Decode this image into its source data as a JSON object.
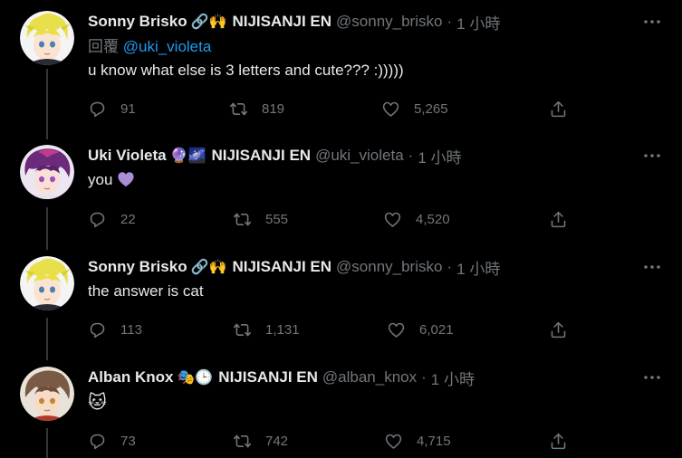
{
  "colors": {
    "background": "#000000",
    "text_primary": "#e7e9ea",
    "text_secondary": "#71767b",
    "link": "#1d9bf0",
    "thread_line": "#333639"
  },
  "tweets": [
    {
      "name": "Sonny Brisko",
      "emojis": "🔗🙌",
      "org": "NIJISANJI EN",
      "handle": "@sonny_brisko",
      "dot": "·",
      "time": "1 小時",
      "reply_label": "回覆",
      "reply_mention": "@uki_violeta",
      "text": "u know what else is 3 letters and cute??? :)))))",
      "avatar": "sonny-avatar",
      "replies": "91",
      "retweets": "819",
      "likes": "5,265"
    },
    {
      "name": "Uki Violeta",
      "emojis": "🔮🌌",
      "org": "NIJISANJI EN",
      "handle": "@uki_violeta",
      "dot": "·",
      "time": "1 小時",
      "text": "you",
      "text_icon": "purple-heart-icon",
      "avatar": "uki-avatar",
      "replies": "22",
      "retweets": "555",
      "likes": "4,520"
    },
    {
      "name": "Sonny Brisko",
      "emojis": "🔗🙌",
      "org": "NIJISANJI EN",
      "handle": "@sonny_brisko",
      "dot": "·",
      "time": "1 小時",
      "text": "the answer is cat",
      "avatar": "sonny-avatar",
      "replies": "113",
      "retweets": "1,131",
      "likes": "6,021"
    },
    {
      "name": "Alban Knox",
      "emojis": "🎭🕒",
      "org": "NIJISANJI EN",
      "handle": "@alban_knox",
      "dot": "·",
      "time": "1 小時",
      "text": "🐱",
      "avatar": "alban-avatar",
      "replies": "73",
      "retweets": "742",
      "likes": "4,715"
    }
  ],
  "icons": {
    "more": "more-dots-icon",
    "reply": "reply-icon",
    "retweet": "retweet-icon",
    "like": "heart-icon",
    "share": "share-icon"
  }
}
